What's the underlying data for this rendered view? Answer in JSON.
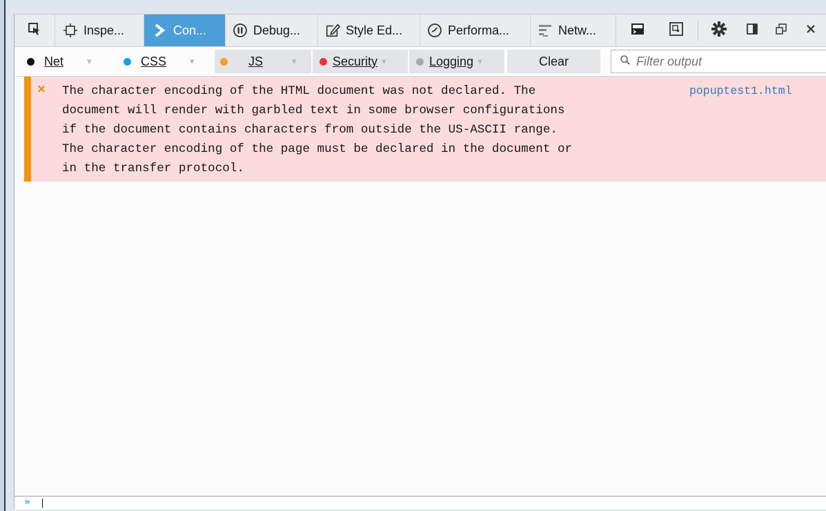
{
  "toolbar": {
    "tabs": [
      {
        "id": "inspector",
        "label": "Inspe...",
        "icon": "inspector-icon"
      },
      {
        "id": "console",
        "label": "Con...",
        "icon": "console-icon",
        "active": true
      },
      {
        "id": "debugger",
        "label": "Debug...",
        "icon": "debugger-icon"
      },
      {
        "id": "style-editor",
        "label": "Style Ed...",
        "icon": "style-editor-icon"
      },
      {
        "id": "performance",
        "label": "Performa...",
        "icon": "performance-icon"
      },
      {
        "id": "network",
        "label": "Netw...",
        "icon": "network-icon"
      }
    ],
    "buttons": [
      "element-picker-icon",
      "split-console-icon",
      "responsive-mode-icon",
      "settings-icon",
      "dock-side-icon",
      "undock-icon",
      "close-icon"
    ],
    "active_color": "#4c9ed9"
  },
  "filters": {
    "net": {
      "label": "Net",
      "dot_color": "#111111"
    },
    "css": {
      "label": "CSS",
      "dot_color": "#18a0e8"
    },
    "js": {
      "label": "JS",
      "dot_color": "#f7a128"
    },
    "security": {
      "label": "Security",
      "dot_color": "#e8333b"
    },
    "logging": {
      "label": "Logging",
      "dot_color": "#aaaaaa"
    },
    "clear_label": "Clear",
    "search_placeholder": "Filter output"
  },
  "messages": [
    {
      "severity": "error",
      "severity_glyph": "×",
      "lines": [
        "The character encoding of the HTML document was not declared. The",
        "document will render with garbled text in some browser configurations",
        "if the document contains characters from outside the US-ASCII range.",
        "The character encoding of the page must be declared in the document or",
        "in the transfer protocol."
      ],
      "source": "popuptest1.html"
    }
  ],
  "input": {
    "prompt": "»"
  }
}
